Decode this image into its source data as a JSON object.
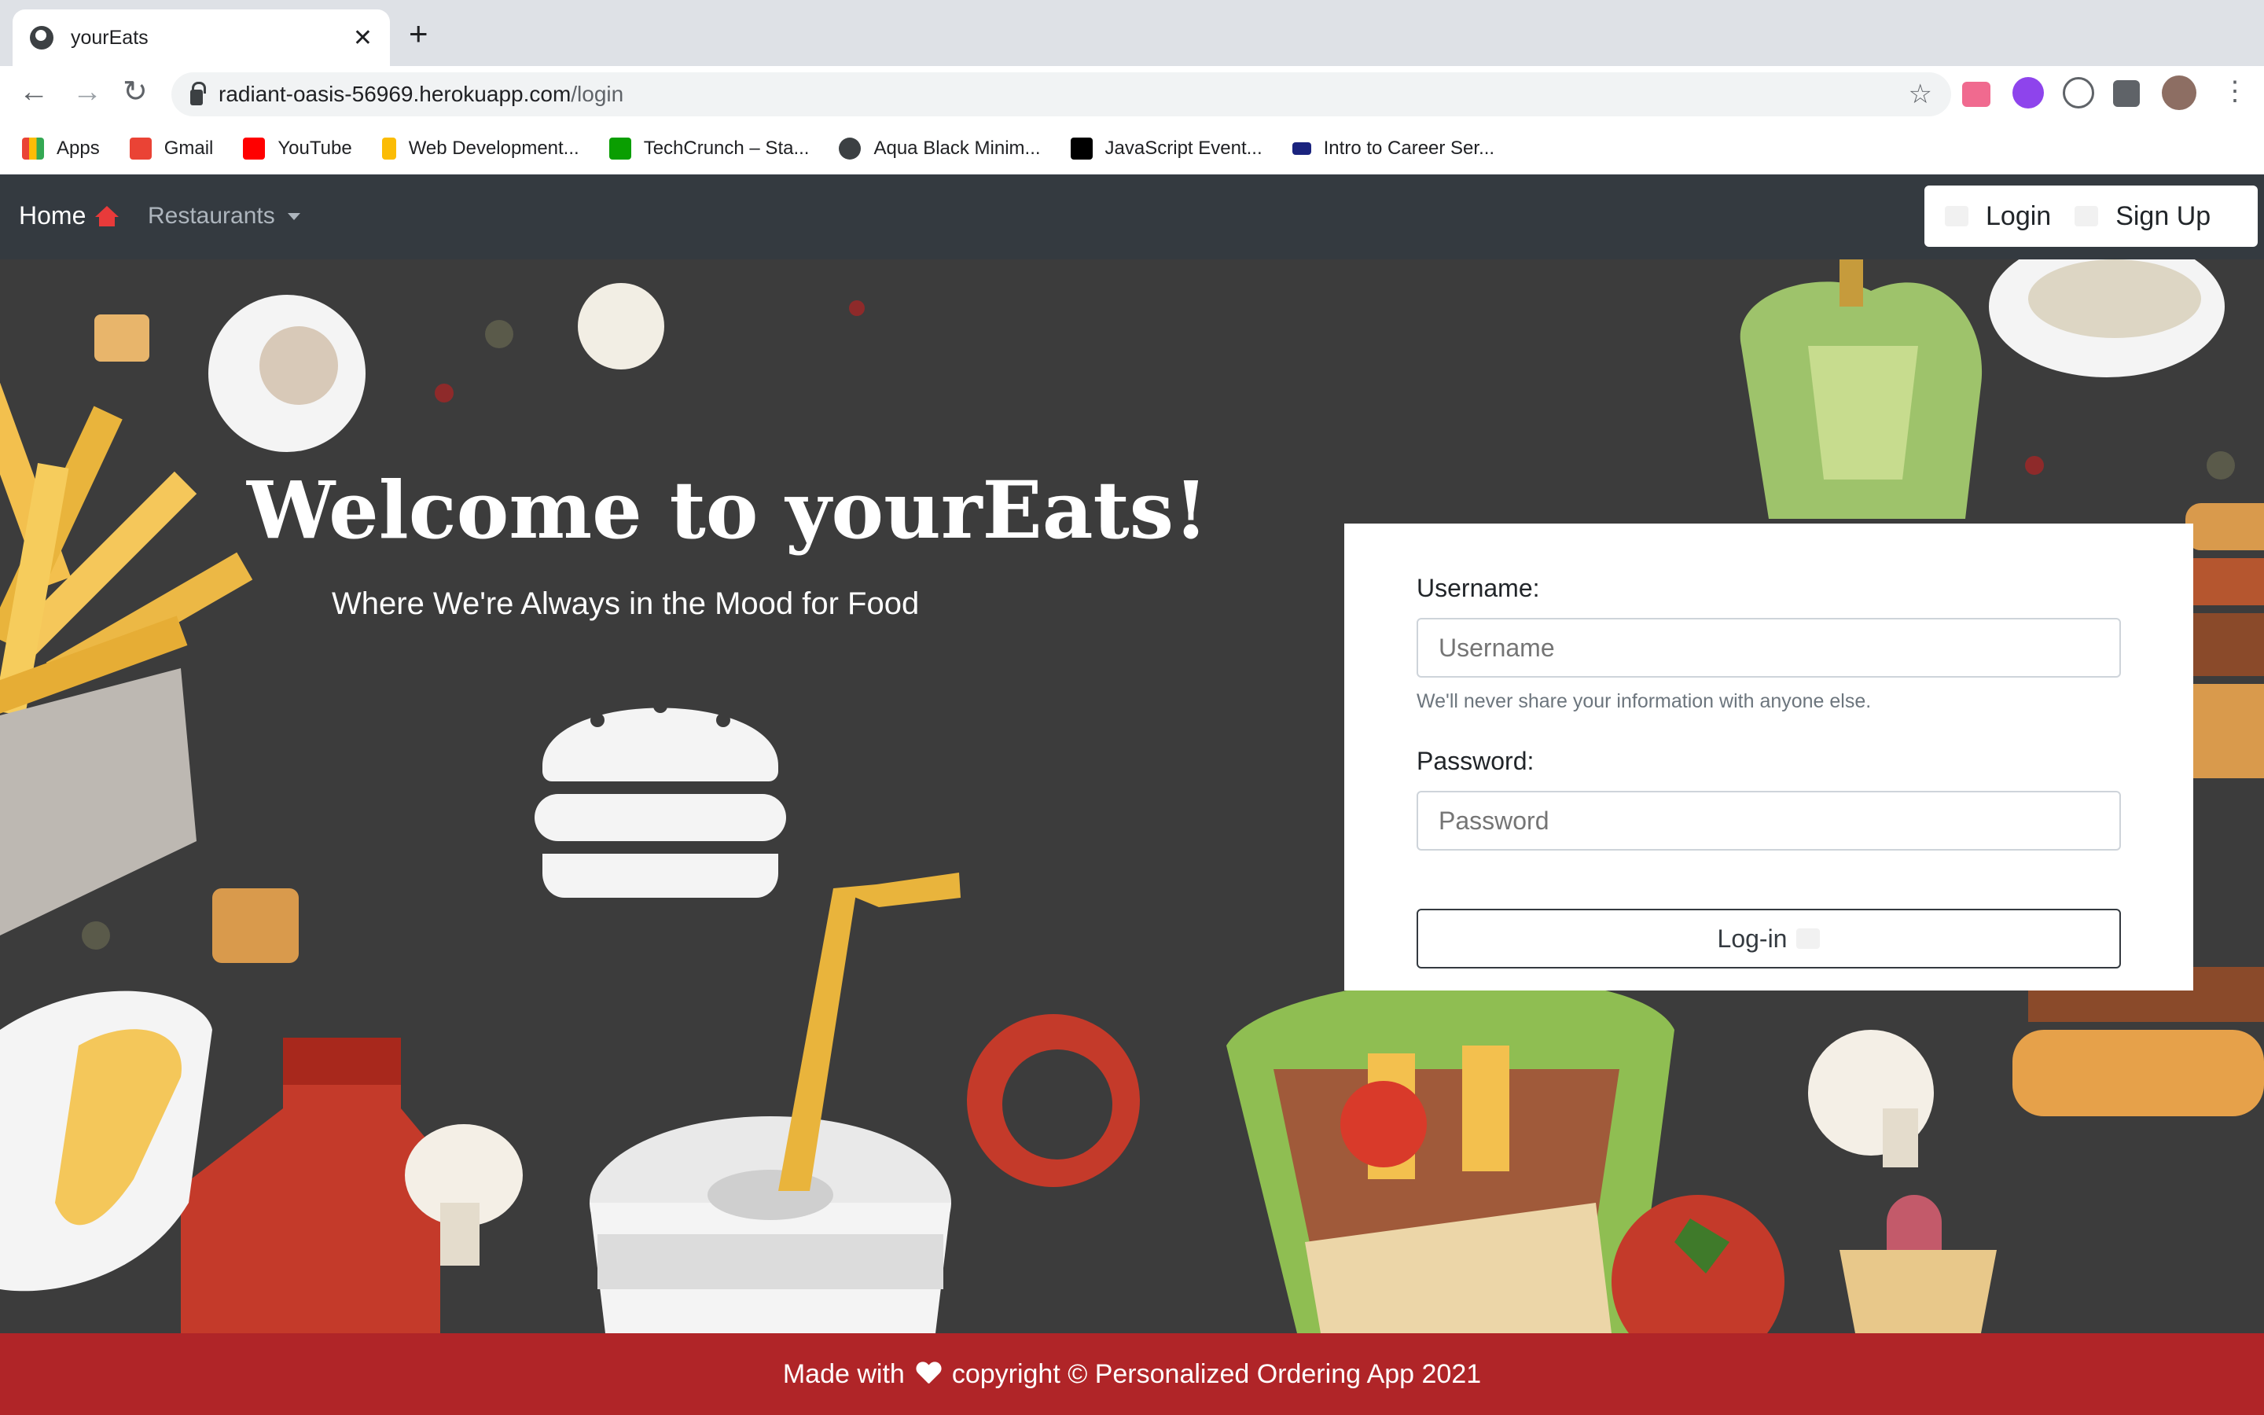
{
  "browser": {
    "tab_title": "yourEats",
    "url_host": "radiant-oasis-56969.herokuapp.com",
    "url_path": "/login",
    "bookmarks": [
      {
        "label": "Apps",
        "icon": "apps-grid-icon",
        "color": "#4285f4"
      },
      {
        "label": "Gmail",
        "icon": "gmail-icon",
        "color": "#ea4335"
      },
      {
        "label": "YouTube",
        "icon": "youtube-icon",
        "color": "#ff0000"
      },
      {
        "label": "Web Development...",
        "icon": "bookmark-favicon",
        "color": "#fbbc05"
      },
      {
        "label": "TechCrunch – Sta...",
        "icon": "techcrunch-icon",
        "color": "#0a9e01"
      },
      {
        "label": "Aqua Black Minim...",
        "icon": "globe-icon",
        "color": "#3c4043"
      },
      {
        "label": "JavaScript Event...",
        "icon": "medium-icon",
        "color": "#000000"
      },
      {
        "label": "Intro to Career Ser...",
        "icon": "cs-icon",
        "color": "#1a237e"
      }
    ]
  },
  "navbar": {
    "home_label": "Home",
    "restaurants_label": "Restaurants",
    "login_label": "Login",
    "signup_label": "Sign Up"
  },
  "hero": {
    "title": "Welcome to yourEats!",
    "tagline": "Where We're Always in the Mood for Food"
  },
  "login_form": {
    "username_label": "Username:",
    "username_placeholder": "Username",
    "help_text": "We'll never share your information with anyone else.",
    "password_label": "Password:",
    "password_placeholder": "Password",
    "submit_label": "Log-in"
  },
  "footer": {
    "before_heart": "Made with",
    "after_heart": "copyright © Personalized Ordering App 2021"
  },
  "colors": {
    "navbar_bg": "#343a40",
    "hero_bg": "#3c3c3c",
    "footer_bg": "#b02528",
    "accent_red": "#e83a3a"
  }
}
